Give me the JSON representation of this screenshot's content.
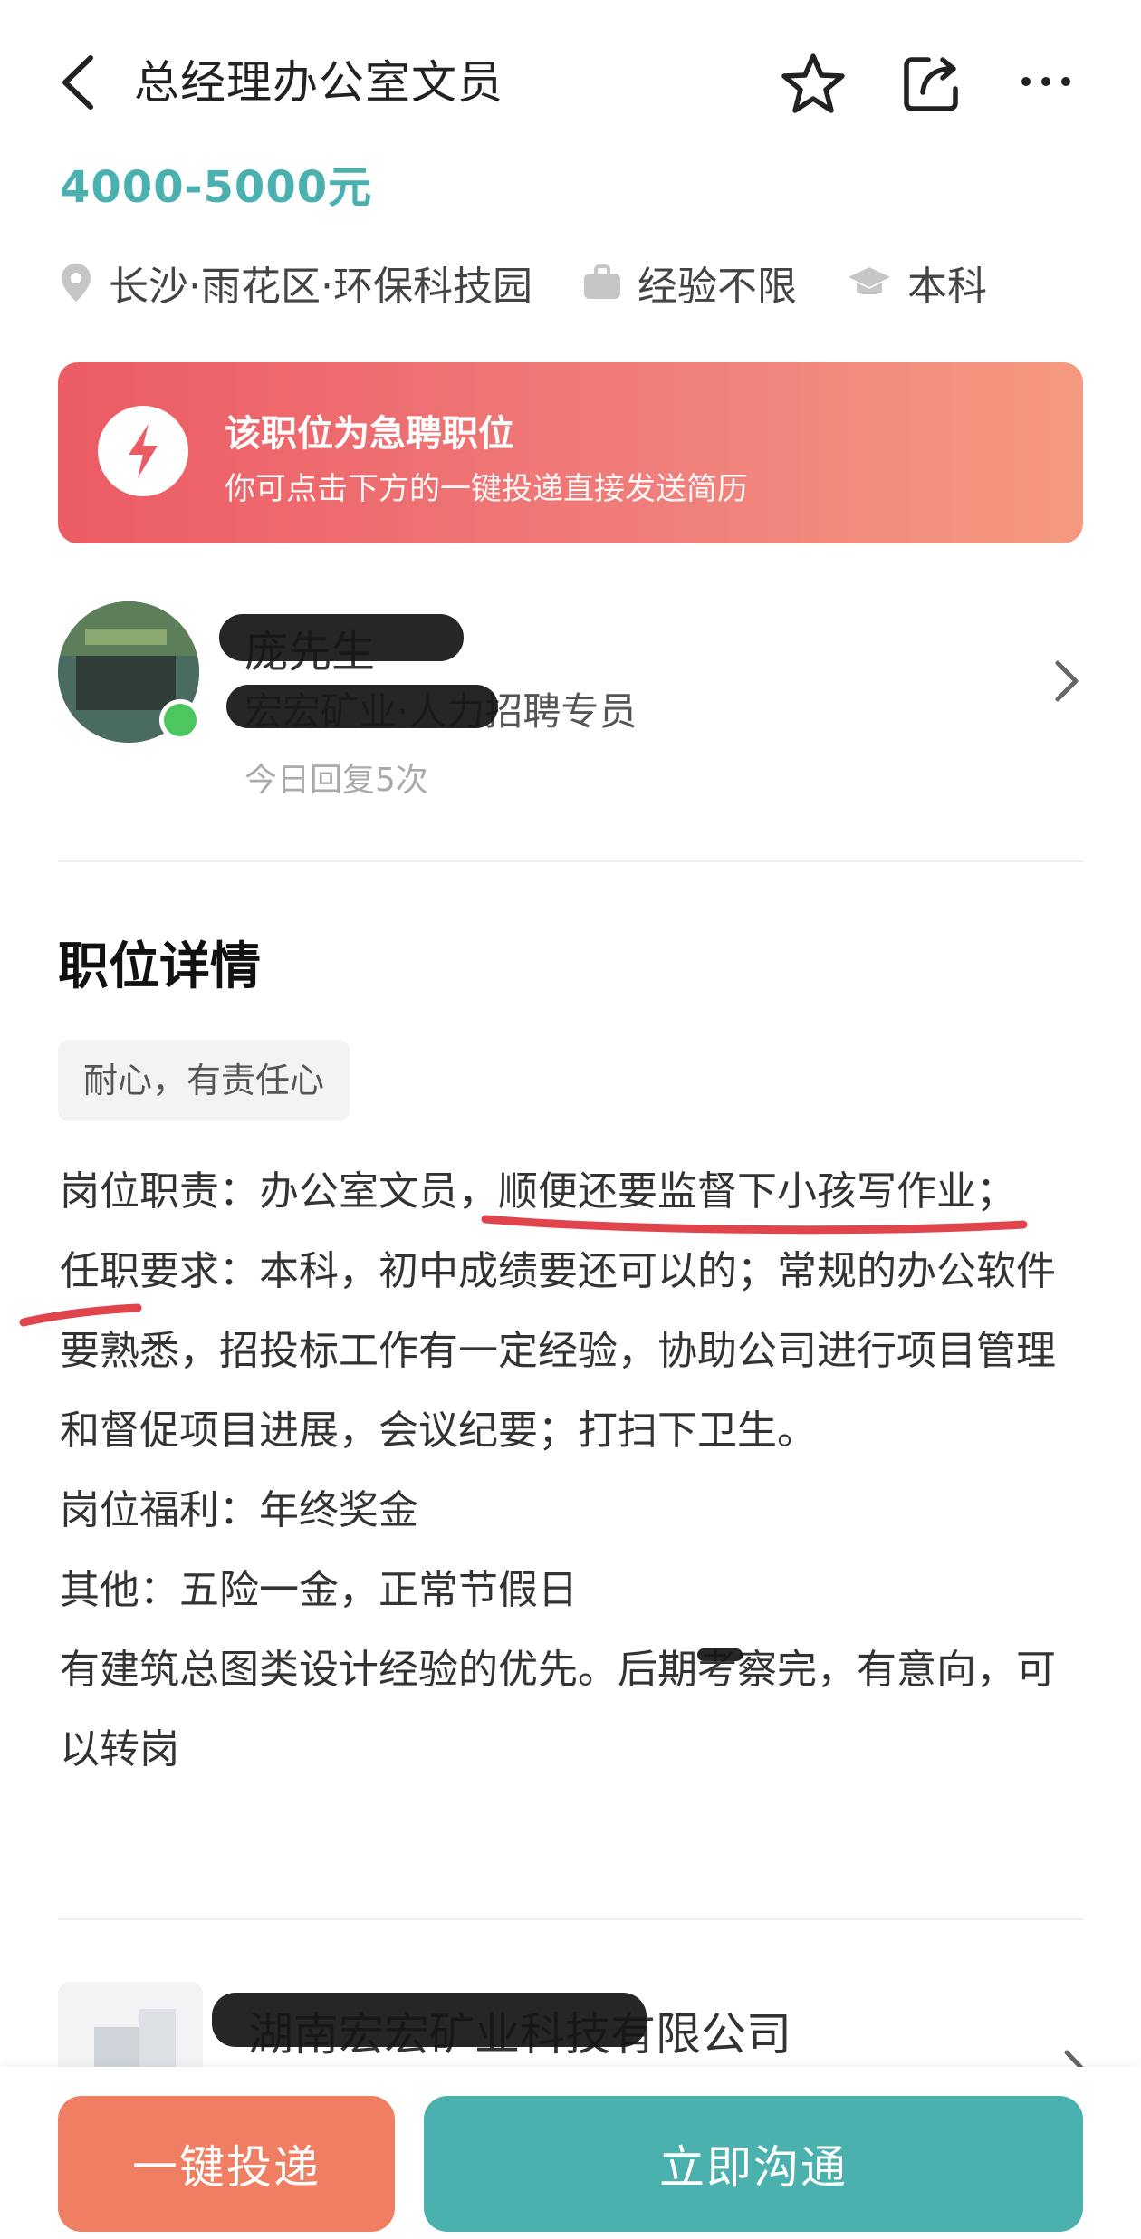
{
  "header": {
    "title": "总经理办公室文员",
    "icons": [
      "chevron-left-icon",
      "star-icon",
      "share-icon",
      "more-icon"
    ]
  },
  "job": {
    "salary": "4000-5000元",
    "location": "长沙·雨花区·环保科技园",
    "experience": "经验不限",
    "education": "本科"
  },
  "banner": {
    "title": "该职位为急聘职位",
    "subtitle": "你可点击下方的一键投递直接发送简历"
  },
  "recruiter": {
    "name": "庞先生",
    "role": "宏宏矿业·人力招聘专员",
    "reply": "今日回复5次"
  },
  "details": {
    "section_title": "职位详情",
    "tag": "耐心，有责任心",
    "lines": [
      "岗位职责：办公室文员，顺便还要监督下小孩写作业；",
      "任职要求：本科，初中成绩要还可以的；常规的办公软件要熟悉，招投标工作有一定经验，协助公司进行项目管理和督促项目进展，会议纪要；打扫下卫生。",
      "岗位福利：年终奖金",
      "其他：五险一金，正常节假日",
      "有建筑总图类设计经验的优先。后期考察完，有意向，可以转岗"
    ]
  },
  "company": {
    "name": "湖南宏宏矿业科技有限公司"
  },
  "actions": {
    "apply": "一键投递",
    "chat": "立即沟通"
  },
  "colors": {
    "accent": "#4ab0b0",
    "apply": "#ef7e63",
    "chat": "#4ab1ae",
    "banner": "#ec5b64",
    "annotation": "#e0454c"
  }
}
